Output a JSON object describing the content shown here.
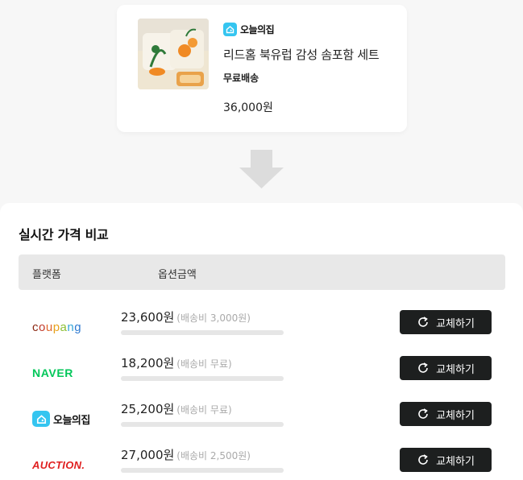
{
  "product": {
    "brand": "오늘의집",
    "name": "리드홈 북유럽 감성 솜포함 세트",
    "shipping": "무료배송",
    "price": "36,000원"
  },
  "comparison": {
    "title": "실시간 가격 비교",
    "headers": {
      "platform": "플랫폼",
      "option_price": "옵션금액"
    },
    "rows": [
      {
        "platform": "coupang",
        "price": "23,600원",
        "shipping": "(배송비 3,000원)",
        "button": "교체하기"
      },
      {
        "platform": "NAVER",
        "price": "18,200원",
        "shipping": "(배송비 무료)",
        "button": "교체하기"
      },
      {
        "platform": "오늘의집",
        "price": "25,200원",
        "shipping": "(배송비 무료)",
        "button": "교체하기"
      },
      {
        "platform": "AUCTION.",
        "price": "27,000원",
        "shipping": "(배송비 2,500원)",
        "button": "교체하기"
      }
    ]
  },
  "colors": {
    "ohou_blue": "#35c5f0",
    "naver_green": "#03c75a",
    "auction_red": "#e02020",
    "button_dark": "#1d1f1f"
  }
}
